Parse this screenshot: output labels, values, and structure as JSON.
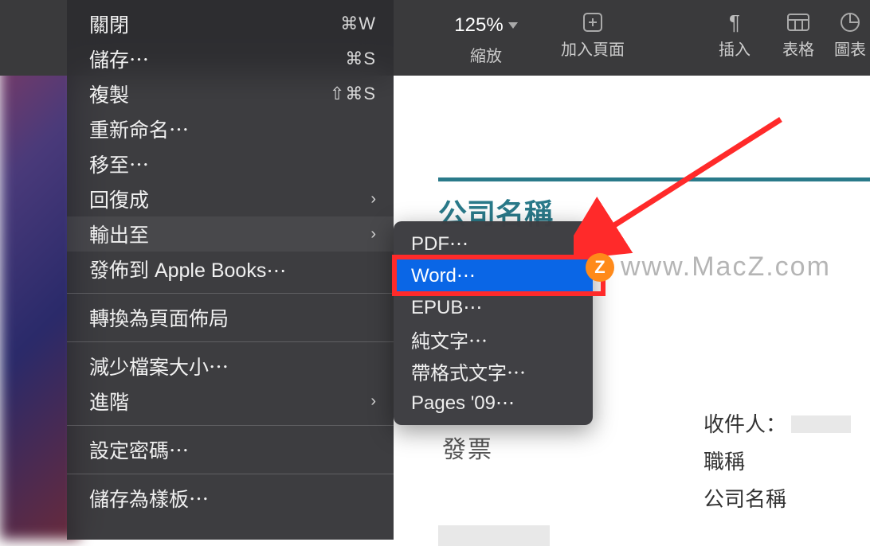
{
  "toolbar": {
    "zoom": {
      "value": "125%",
      "label": "縮放"
    },
    "addPage": {
      "label": "加入頁面"
    },
    "insert": {
      "label": "插入"
    },
    "table": {
      "label": "表格"
    },
    "chart": {
      "label": "圖表"
    }
  },
  "menu": {
    "items": [
      {
        "label": "關閉",
        "shortcut": "⌘W"
      },
      {
        "label": "儲存⋯",
        "shortcut": "⌘S"
      },
      {
        "label": "複製",
        "shortcut": "⇧⌘S"
      },
      {
        "label": "重新命名⋯"
      },
      {
        "label": "移至⋯"
      },
      {
        "label": "回復成",
        "submenu": true
      },
      {
        "label": "輸出至",
        "submenu": true,
        "hover": true
      },
      {
        "label": "發佈到 Apple Books⋯"
      }
    ],
    "group2": [
      {
        "label": "轉換為頁面佈局"
      }
    ],
    "group3": [
      {
        "label": "減少檔案大小⋯"
      },
      {
        "label": "進階",
        "submenu": true
      }
    ],
    "group4": [
      {
        "label": "設定密碼⋯"
      }
    ],
    "group5": [
      {
        "label": "儲存為樣板⋯"
      }
    ]
  },
  "submenu": {
    "items": [
      {
        "label": "PDF⋯"
      },
      {
        "label": "Word⋯",
        "selected": true
      },
      {
        "label": "EPUB⋯"
      },
      {
        "label": "純文字⋯"
      },
      {
        "label": "帶格式文字⋯"
      },
      {
        "label": "Pages '09⋯"
      }
    ]
  },
  "document": {
    "title": "公司名稱",
    "word": "發票",
    "fields": {
      "recipient": "收件人：",
      "jobTitle": "職稱",
      "company": "公司名稱"
    }
  },
  "watermark": {
    "badge": "Z",
    "text": "www.MacZ.com"
  }
}
